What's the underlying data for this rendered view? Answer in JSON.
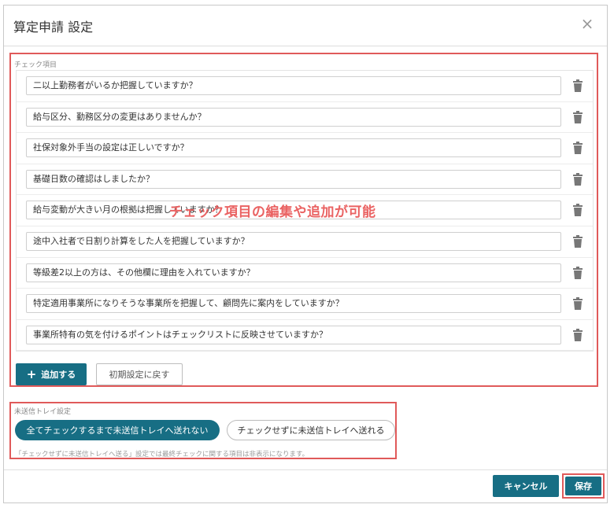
{
  "dialog": {
    "title": "算定申請 設定",
    "close_glyph": "×"
  },
  "check_section": {
    "label": "チェック項目",
    "items": [
      "二以上勤務者がいるか把握していますか？",
      "給与区分、勤務区分の変更はありませんか？",
      "社保対象外手当の設定は正しいですか？",
      "基礎日数の確認はしましたか？",
      "給与変動が大きい月の根拠は把握していますか？",
      "途中入社者で日割り計算をした人を把握していますか？",
      "等級差2以上の方は、その他欄に理由を入れていますか？",
      "特定適用事業所になりそうな事業所を把握して、顧問先に案内をしていますか？",
      "事業所特有の気を付けるポイントはチェックリストに反映させていますか？"
    ],
    "overlay_note": "チェック項目の編集や追加が可能",
    "add_button": "追加する",
    "reset_button": "初期設定に戻す"
  },
  "tray_section": {
    "label": "未送信トレイ設定",
    "option_selected": "全てチェックするまで未送信トレイへ送れない",
    "option_other": "チェックせずに未送信トレイへ送れる",
    "note": "「チェックせずに未送信トレイへ送る」設定では最終チェックに関する項目は非表示になります。"
  },
  "footer": {
    "cancel_button": "キャンセル",
    "save_button": "保存"
  },
  "colors": {
    "accent": "#176e84",
    "highlight": "#e05a5a",
    "annotation": "#ea6363"
  },
  "icons": {
    "delete": "trash-icon",
    "add": "plus-icon",
    "close": "close-icon"
  }
}
